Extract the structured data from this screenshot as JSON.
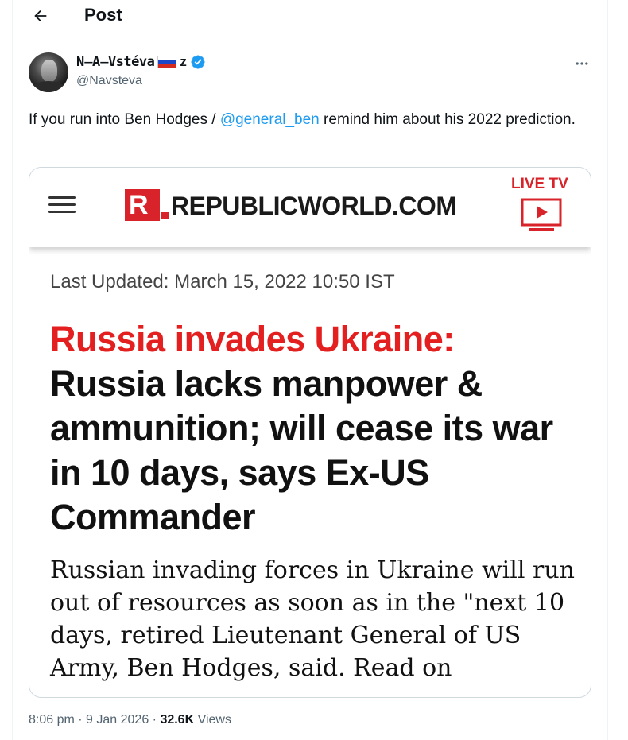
{
  "header": {
    "title": "Post"
  },
  "author": {
    "display_name_prefix": "N̶A̶Vstéva",
    "display_name_suffix": "z",
    "handle": "@Navsteva"
  },
  "tweet": {
    "text_before": "If you run into Ben Hodges / ",
    "mention": "@general_ben",
    "text_after": " remind him about his 2022 prediction."
  },
  "media": {
    "site_name": "REPUBLICWORLD.COM",
    "logo_letter": "R",
    "live_tv": "LIVE TV",
    "last_updated": "Last Updated: March 15, 2022 10:50 IST",
    "headline_red": "Russia invades Ukraine:",
    "headline_black": "Russia lacks manpower & ammunition; will cease its war in 10 days, says Ex-US Commander",
    "summary": "Russian invading forces in Ukraine will run out of resources as soon as in the \"next 10 days, retired Lieutenant General of US Army, Ben Hodges, said. Read on"
  },
  "meta": {
    "time": "8:06 pm",
    "date": "9 Jan 2026",
    "views_count": "32.6K",
    "views_label": "Views"
  },
  "icons": {
    "back": "arrow-left-icon",
    "verified": "verified-badge-icon",
    "more": "more-horizontal-icon",
    "menu": "hamburger-menu-icon",
    "live_tv": "live-tv-play-icon",
    "flag": "russia-flag-icon"
  },
  "colors": {
    "link": "#1d9bf0",
    "verified": "#1d9bf0",
    "brand_red": "#d8232a",
    "headline_red": "#e41f1f",
    "muted": "#536471"
  }
}
